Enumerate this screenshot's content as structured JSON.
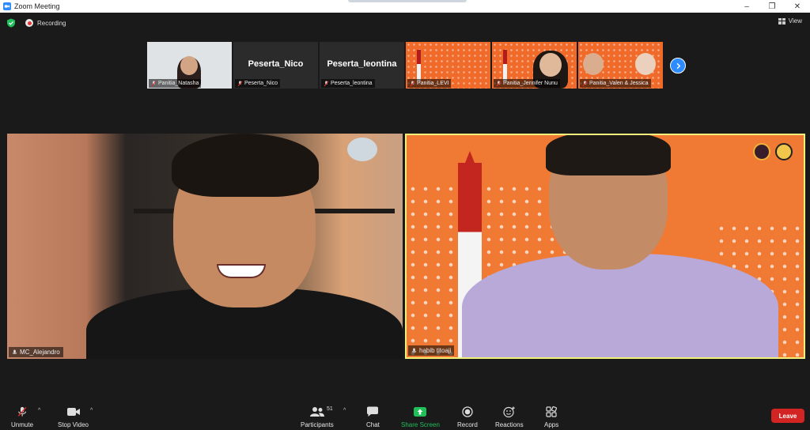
{
  "window": {
    "title": "Zoom Meeting",
    "controls": {
      "minimize": "–",
      "maximize": "❐",
      "close": "✕"
    }
  },
  "status": {
    "recording_label": "Recording",
    "view_label": "View"
  },
  "thumbnails": [
    {
      "name": "Panitia_Natasha",
      "muted": true,
      "type": "video"
    },
    {
      "name": "Peserta_Nico",
      "display_name": "Peserta_Nico",
      "muted": true,
      "type": "name"
    },
    {
      "name": "Peserta_leontina",
      "display_name": "Peserta_leontina",
      "muted": true,
      "type": "name"
    },
    {
      "name": "Panitia_LEVI",
      "muted": true,
      "type": "video"
    },
    {
      "name": "Panitia_Jennifer Nunu",
      "muted": true,
      "type": "video"
    },
    {
      "name": "Panitia_Valen & Jessica",
      "muted": true,
      "type": "video"
    }
  ],
  "main_tiles": [
    {
      "name": "MC_Alejandro",
      "muted": false,
      "active_speaker": false
    },
    {
      "name": "habib titoaji",
      "muted": false,
      "active_speaker": true
    }
  ],
  "toolbar": {
    "unmute": "Unmute",
    "stop_video": "Stop Video",
    "participants": "Participants",
    "participant_count": "51",
    "chat": "Chat",
    "share_screen": "Share Screen",
    "record": "Record",
    "reactions": "Reactions",
    "apps": "Apps",
    "leave": "Leave",
    "caret": "^"
  },
  "colors": {
    "accent": "#2d8cff",
    "share_green": "#1fbf5a",
    "leave_red": "#d32424",
    "active_speaker_border": "#f0f07a",
    "background_orange": "#f07a33"
  }
}
